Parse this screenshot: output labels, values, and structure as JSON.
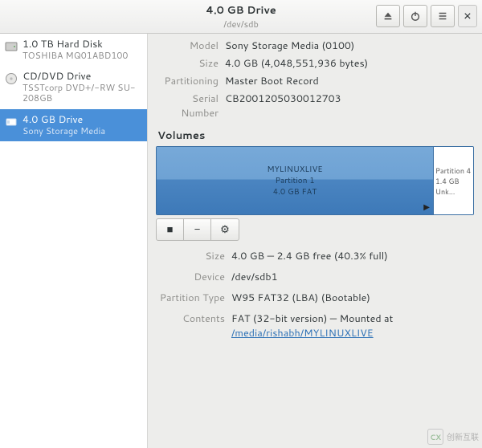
{
  "header": {
    "title": "4.0 GB Drive",
    "subtitle": "/dev/sdb"
  },
  "sidebar": {
    "devices": [
      {
        "title": "1.0 TB Hard Disk",
        "sub": "TOSHIBA MQ01ABD100",
        "icon": "hdd"
      },
      {
        "title": "CD/DVD Drive",
        "sub": "TSSTcorp DVD+/-RW SU-208GB",
        "icon": "optical"
      },
      {
        "title": "4.0 GB Drive",
        "sub": "Sony Storage Media",
        "icon": "usb"
      }
    ],
    "selected_index": 2
  },
  "drive_info": {
    "model_label": "Model",
    "model": "Sony Storage Media (0100)",
    "size_label": "Size",
    "size": "4.0 GB (4,048,551,936 bytes)",
    "partitioning_label": "Partitioning",
    "partitioning": "Master Boot Record",
    "serial_label": "Serial Number",
    "serial": "CB2001205030012703"
  },
  "volumes": {
    "heading": "Volumes",
    "main": {
      "name": "MYLINUXLIVE",
      "line2": "Partition 1",
      "line3": "4.0 GB FAT"
    },
    "side": {
      "name": "Partition 4",
      "line2": "1.4 GB Unk…"
    }
  },
  "toolbar": {
    "stop": "■",
    "minus": "−",
    "gear": "⚙"
  },
  "volume_detail": {
    "size_label": "Size",
    "size": "4.0 GB — 2.4 GB free (40.3% full)",
    "device_label": "Device",
    "device": "/dev/sdb1",
    "ptype_label": "Partition Type",
    "ptype": "W95 FAT32 (LBA) (Bootable)",
    "contents_label": "Contents",
    "contents_prefix": "FAT (32-bit version) — Mounted at ",
    "contents_link": "/media/rishabh/MYLINUXLIVE"
  },
  "watermark": {
    "text": "创新互联"
  }
}
